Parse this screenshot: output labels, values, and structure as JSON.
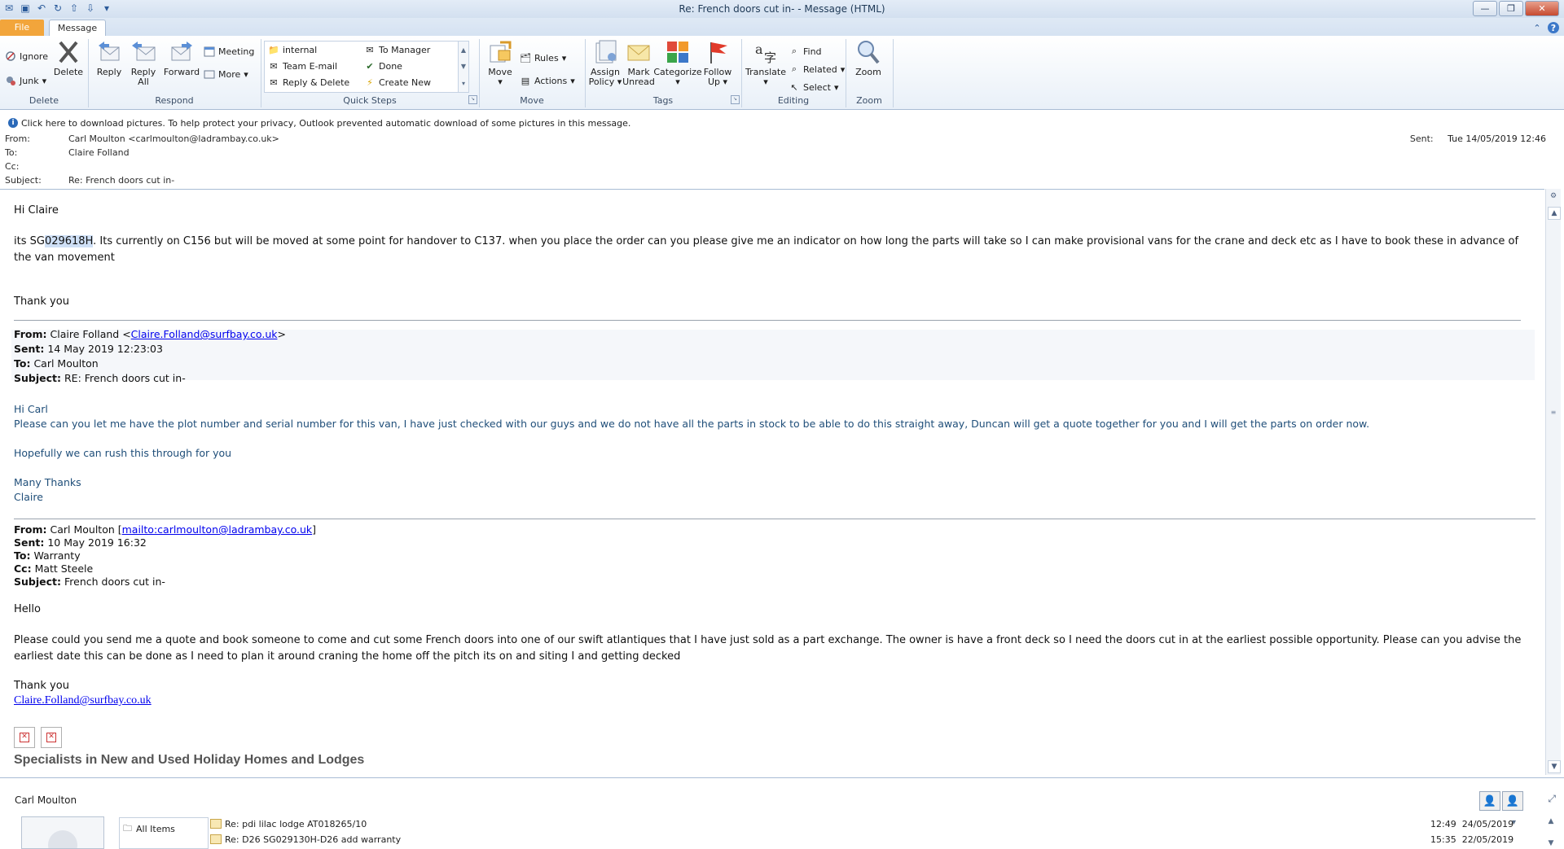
{
  "window": {
    "title": "Re: French doors cut in-  -  Message (HTML)"
  },
  "tabs": {
    "file": "File",
    "message": "Message"
  },
  "ribbon": {
    "delete": {
      "ignore": "Ignore",
      "junk": "Junk",
      "delete": "Delete",
      "label": "Delete"
    },
    "respond": {
      "reply": "Reply",
      "reply_all_1": "Reply",
      "reply_all_2": "All",
      "forward": "Forward",
      "meeting": "Meeting",
      "more": "More",
      "label": "Respond"
    },
    "quick_steps": {
      "items": [
        "internal",
        "To Manager",
        "Team E-mail",
        "Done",
        "Reply & Delete",
        "Create New"
      ],
      "label": "Quick Steps"
    },
    "move": {
      "move": "Move",
      "rules": "Rules",
      "actions": "Actions",
      "label": "Move"
    },
    "tags": {
      "assign_1": "Assign",
      "assign_2": "Policy",
      "mark_1": "Mark",
      "mark_2": "Unread",
      "categorize": "Categorize",
      "follow_1": "Follow",
      "follow_2": "Up",
      "label": "Tags"
    },
    "editing": {
      "translate": "Translate",
      "find": "Find",
      "related": "Related",
      "select": "Select",
      "label": "Editing"
    },
    "zoom": {
      "zoom": "Zoom",
      "label": "Zoom"
    }
  },
  "infobar": {
    "text": "Click here to download pictures. To help protect your privacy, Outlook prevented automatic download of some pictures in this message."
  },
  "header": {
    "from_label": "From:",
    "from": "Carl Moulton <carlmoulton@ladrambay.co.uk>",
    "to_label": "To:",
    "to": "Claire Folland",
    "cc_label": "Cc:",
    "cc": "",
    "subject_label": "Subject:",
    "subject": "Re: French doors cut in-",
    "sent_label": "Sent:",
    "sent": "Tue 14/05/2019 12:46"
  },
  "body": {
    "greeting": "Hi Claire",
    "line1_pre": "its SG",
    "line1_hl": "029618H",
    "line1_post": ". Its currently on C156 but will be moved at some point for handover to C137. when you place the order can you please give me an indicator on how long the parts will take so I can make provisional vans for the crane and deck etc as I have to book these in advance of the van movement",
    "thanks": "Thank you",
    "q1": {
      "from_label": "From:",
      "from_name": "Claire Folland <",
      "from_email": "Claire.Folland@surfbay.co.uk",
      "from_close": ">",
      "sent_label": "Sent:",
      "sent": "14 May 2019 12:23:03",
      "to_label": "To:",
      "to": "Carl Moulton",
      "subject_label": "Subject:",
      "subject": "RE: French doors cut in-",
      "hi": "Hi Carl",
      "text": "Please can you let me have the plot number and serial number for this van, I have just checked with our guys and we do not have all the parts in stock to be able to do this straight away, Duncan will get a quote together for you and I will get the parts on order now.",
      "rush": "Hopefully we can rush this through for you",
      "thanks": "Many Thanks",
      "sign": "Claire"
    },
    "q2": {
      "from_label": "From:",
      "from_name": "Carl Moulton [",
      "from_email": "mailto:carlmoulton@ladrambay.co.uk",
      "from_close": "]",
      "sent_label": "Sent:",
      "sent": "10 May 2019 16:32",
      "to_label": "To:",
      "to": "Warranty",
      "cc_label": "Cc:",
      "cc": "Matt Steele",
      "subject_label": "Subject:",
      "subject": "French doors cut in-",
      "hello": "Hello",
      "text": "Please could you send me a quote and book someone to come and cut some French doors into one of our swift atlantiques that I have just sold as a part exchange. The owner is have a front deck so I need the doors cut in at the earliest possible opportunity. Please can you advise the earliest date this can be done as I need to plan it around craning the home off the pitch its on and siting I and getting decked",
      "thanks": "Thank you",
      "link": "Claire.Folland@surfbay.co.uk",
      "tagline": "Specialists in New and Used Holiday Homes and Lodges"
    }
  },
  "people_pane": {
    "name": "Carl Moulton",
    "all_items": "All Items",
    "messages": [
      {
        "subject": "Re: pdi lilac lodge AT018265/10",
        "time": "12:49",
        "date": "24/05/2019"
      },
      {
        "subject": "Re: D26 SG029130H-D26 add warranty",
        "time": "15:35",
        "date": "22/05/2019"
      }
    ]
  }
}
